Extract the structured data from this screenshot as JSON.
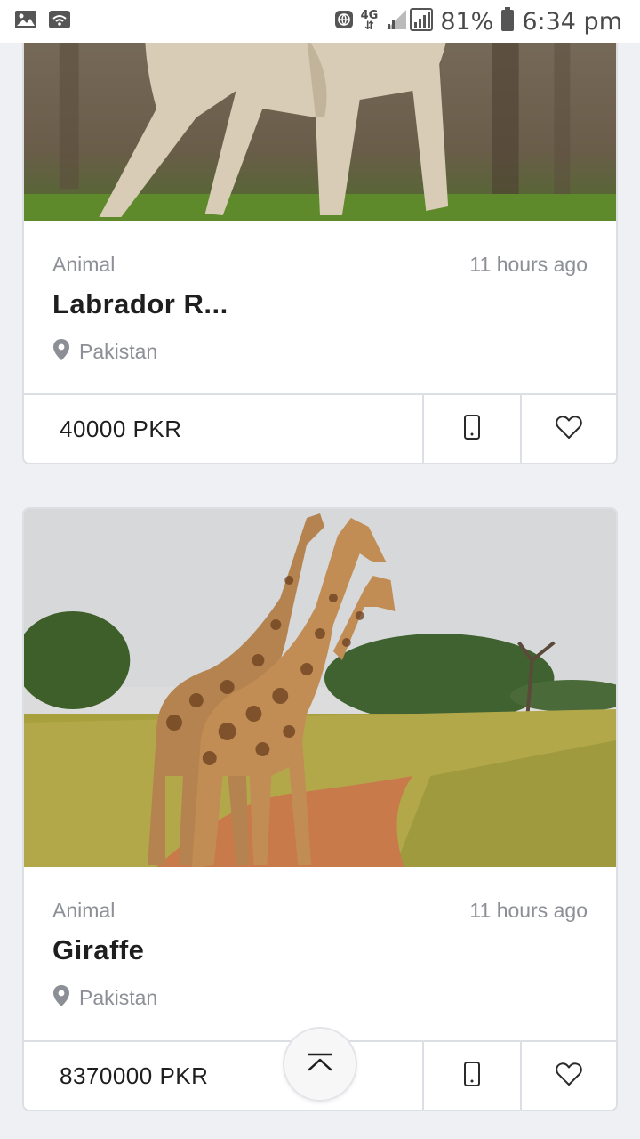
{
  "status_bar": {
    "network_label_top": "4G",
    "battery_percent": "81%",
    "time": "6:34 pm",
    "icons": [
      "gallery-icon",
      "wifi-icon",
      "globe-icon",
      "signal-icon",
      "battery-icon"
    ]
  },
  "listings": [
    {
      "category": "Animal",
      "time": "11 hours ago",
      "title": "Labrador R...",
      "location": "Pakistan",
      "price": "40000 PKR",
      "image": "dog-photo"
    },
    {
      "category": "Animal",
      "time": "11 hours ago",
      "title": "Giraffe",
      "location": "Pakistan",
      "price": "8370000 PKR",
      "image": "giraffe-photo"
    }
  ],
  "colors": {
    "background": "#eef0f4",
    "card_border": "#dcdfe4",
    "muted_text": "#8c8f95",
    "primary_text": "#1e1e1e"
  }
}
